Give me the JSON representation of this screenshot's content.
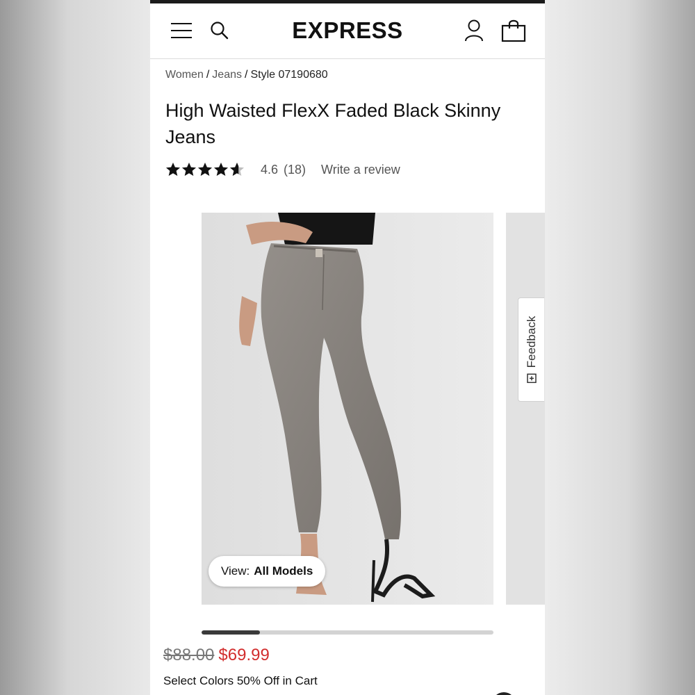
{
  "brand": {
    "logo_text": "EXPRESS"
  },
  "breadcrumb": {
    "items": [
      "Women",
      "Jeans"
    ],
    "separator": "/",
    "current": "Style 07190680"
  },
  "product": {
    "title": "High Waisted FlexX Faded Black Skinny Jeans",
    "rating": {
      "stars": 4.6,
      "stars_max": 5,
      "value_text": "4.6",
      "count_text": "(18)",
      "write_review": "Write a review"
    },
    "gallery": {
      "view_prefix": "View:",
      "view_value": "All Models",
      "scroll_progress": 0.2
    },
    "price": {
      "original": "$88.00",
      "sale": "$69.99"
    },
    "promo": "Select Colors 50% Off in Cart"
  },
  "feedback_tab": {
    "label": "Feedback"
  },
  "colors": {
    "sale_red": "#d22d2d",
    "text_dark": "#111111",
    "text_muted": "#555555",
    "image_bg": "#e4e4e4",
    "denim_grey": "#8a8580"
  },
  "icons": [
    "menu-icon",
    "search-icon",
    "account-icon",
    "shopping-bag-icon",
    "star-icon",
    "feedback-icon"
  ]
}
